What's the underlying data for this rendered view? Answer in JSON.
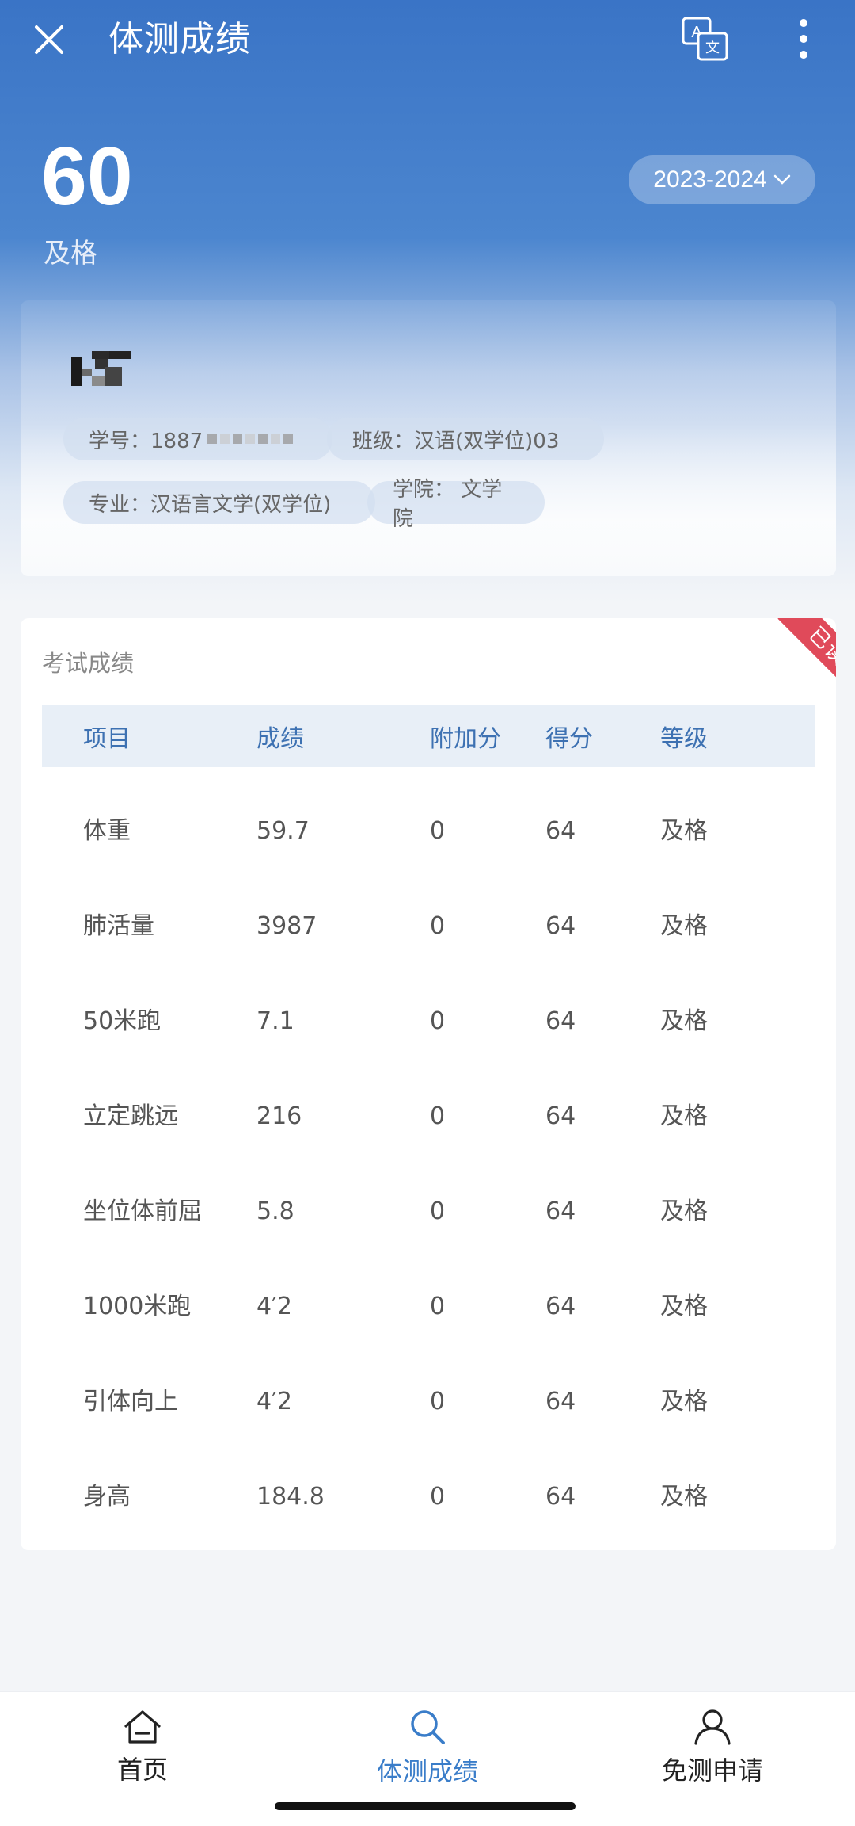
{
  "header": {
    "title": "体测成绩"
  },
  "summary": {
    "score": "60",
    "level": "及格",
    "year": "2023-2024"
  },
  "student": {
    "student_id": "学号：1887",
    "class": "班级：汉语(双学位)03",
    "major": "专业：汉语言文学(双学位)",
    "college": "学院： 文学院"
  },
  "exam": {
    "title": "考试成绩",
    "read_badge": "已读",
    "columns": [
      "项目",
      "成绩",
      "附加分",
      "得分",
      "等级"
    ],
    "rows": [
      {
        "item": "体重",
        "result": "59.7",
        "bonus": "0",
        "points": "64",
        "grade": "及格"
      },
      {
        "item": "肺活量",
        "result": "3987",
        "bonus": "0",
        "points": "64",
        "grade": "及格"
      },
      {
        "item": "50米跑",
        "result": "7.1",
        "bonus": "0",
        "points": "64",
        "grade": "及格"
      },
      {
        "item": "立定跳远",
        "result": "216",
        "bonus": "0",
        "points": "64",
        "grade": "及格"
      },
      {
        "item": "坐位体前屈",
        "result": "5.8",
        "bonus": "0",
        "points": "64",
        "grade": "及格"
      },
      {
        "item": "1000米跑",
        "result": "4′2",
        "bonus": "0",
        "points": "64",
        "grade": "及格"
      },
      {
        "item": "引体向上",
        "result": "4′2",
        "bonus": "0",
        "points": "64",
        "grade": "及格"
      },
      {
        "item": "身高",
        "result": "184.8",
        "bonus": "0",
        "points": "64",
        "grade": "及格"
      }
    ]
  },
  "nav": {
    "home": "首页",
    "scores": "体测成绩",
    "exempt": "免测申请"
  },
  "colors": {
    "primary": "#3a74c6",
    "active_nav": "#3a7dc9",
    "badge": "#e04a5a"
  }
}
